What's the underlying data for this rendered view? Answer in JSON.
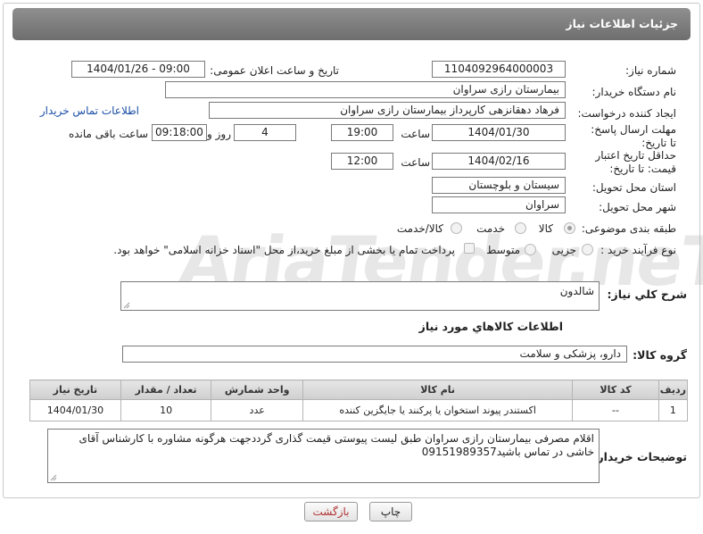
{
  "header": {
    "title": "جزئیات اطلاعات نیاز"
  },
  "labels": {
    "need_number": "شماره نیاز:",
    "public_announce_datetime": "تاریخ و ساعت اعلان عمومی:",
    "buyer_org": "نام دستگاه خریدار:",
    "request_creator": "ایجاد کننده درخواست:",
    "contact_info_link": "اطلاعات تماس خریدار",
    "reply_deadline": "مهلت ارسال پاسخ: تا تاریخ:",
    "hour": "ساعت",
    "days_and": "روز و",
    "hours_remaining": "ساعت باقی مانده",
    "price_validity": "حداقل تاریخ اعتبار قیمت: تا تاریخ:",
    "delivery_province": "استان محل تحویل:",
    "delivery_city": "شهر محل تحویل:",
    "subject_class": "طبقه بندی موضوعی:",
    "purchase_process": "نوع فرآیند خرید :",
    "general_description": "شرح کلي نياز:",
    "items_info": "اطلاعات کالاهاي مورد نياز",
    "goods_group": "گروه کالا:",
    "buyer_notes": "توضیحات خریدار:"
  },
  "values": {
    "need_number": "1104092964000003",
    "public_announce_datetime": "1404/01/26 - 09:00",
    "buyer_org": "بیمارستان رازی سراوان",
    "request_creator": "فرهاد دهقانزهی کارپرداز بیمارستان رازی سراوان",
    "reply_date": "1404/01/30",
    "reply_time": "19:00",
    "days": "4",
    "remaining_time": "09:18:00",
    "price_validity_date": "1404/02/16",
    "price_validity_time": "12:00",
    "delivery_province": "سیستان و بلوچستان",
    "delivery_city": "سراوان",
    "general_description": "شالدون",
    "goods_group": "دارو، پزشکی و سلامت",
    "buyer_notes": "اقلام مصرفی بیمارستان رازی سراوان طبق لیست پیوستی قیمت گذاری گرددجهت هرگونه مشاوره با کارشناس آقای خاشی در تماس باشید09151989357"
  },
  "subject_options": [
    {
      "label": "کالا",
      "selected": true
    },
    {
      "label": "خدمت",
      "selected": false
    },
    {
      "label": "کالا/خدمت",
      "selected": false
    }
  ],
  "process_options": [
    {
      "label": "جزیی",
      "selected": false
    },
    {
      "label": "متوسط",
      "selected": false
    }
  ],
  "payment_note": "پرداخت تمام یا بخشی از مبلغ خرید،از محل \"اسناد خزانه اسلامی\" خواهد بود.",
  "table": {
    "headers": [
      "ردیف",
      "کد کالا",
      "نام کالا",
      "واحد شمارش",
      "تعداد / مقدار",
      "تاریخ نیاز"
    ],
    "rows": [
      [
        "1",
        "--",
        "اکستندر پیوند استخوان یا پرکنند یا جایگزین کننده",
        "عدد",
        "10",
        "1404/01/30"
      ]
    ]
  },
  "buttons": {
    "print": "چاپ",
    "back": "بازگشت"
  },
  "watermark": "AriaTender.neT"
}
